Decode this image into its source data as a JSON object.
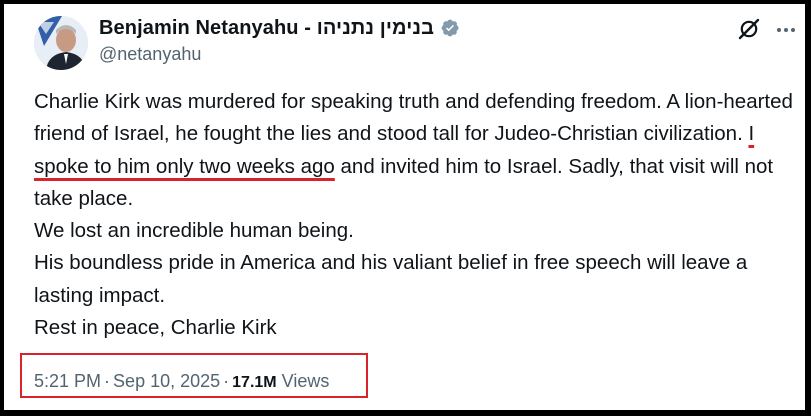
{
  "post": {
    "author": {
      "display_name": "Benjamin Netanyahu - בנימין נתניהו",
      "handle": "@netanyahu",
      "verified": true,
      "verified_color": "#829aab"
    },
    "header_actions": {
      "grok_icon": "grok-icon",
      "more_icon": "more-options-icon"
    },
    "text": {
      "para1_before": "Charlie Kirk was murdered for speaking truth and defending freedom. A lion-hearted friend of Israel, he fought the lies and stood tall for Judeo-Christian civilization. ",
      "para1_highlight": "I spoke to him only two weeks ago",
      "para1_after": " and invited him to Israel. Sadly, that visit will not take place.",
      "para2": "We lost an incredible human being.",
      "para3": "His boundless pride in America and his valiant belief in free speech will leave a lasting impact.",
      "para4": "Rest in peace, Charlie Kirk"
    },
    "meta": {
      "time": "5:21 PM",
      "separator": "·",
      "date": "Sep 10, 2025",
      "views_count": "17.1M",
      "views_label": "Views"
    }
  },
  "annotation_color": "#d8232a"
}
